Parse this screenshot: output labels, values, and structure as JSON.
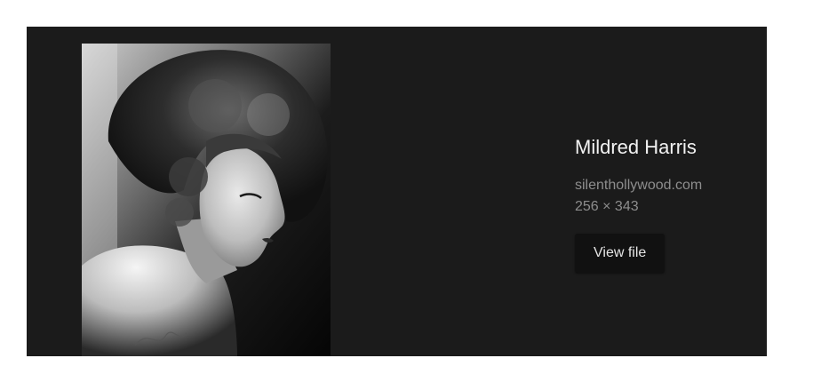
{
  "result": {
    "title": "Mildred Harris",
    "source": "silenthollywood.com",
    "dimensions": "256 × 343",
    "view_file_label": "View file",
    "image_alt": "Mildred Harris",
    "colors": {
      "panel_background": "#1b1b1b",
      "button_background": "#111111",
      "title_text": "#f2f2f2",
      "meta_text": "#8d8d8d"
    }
  }
}
